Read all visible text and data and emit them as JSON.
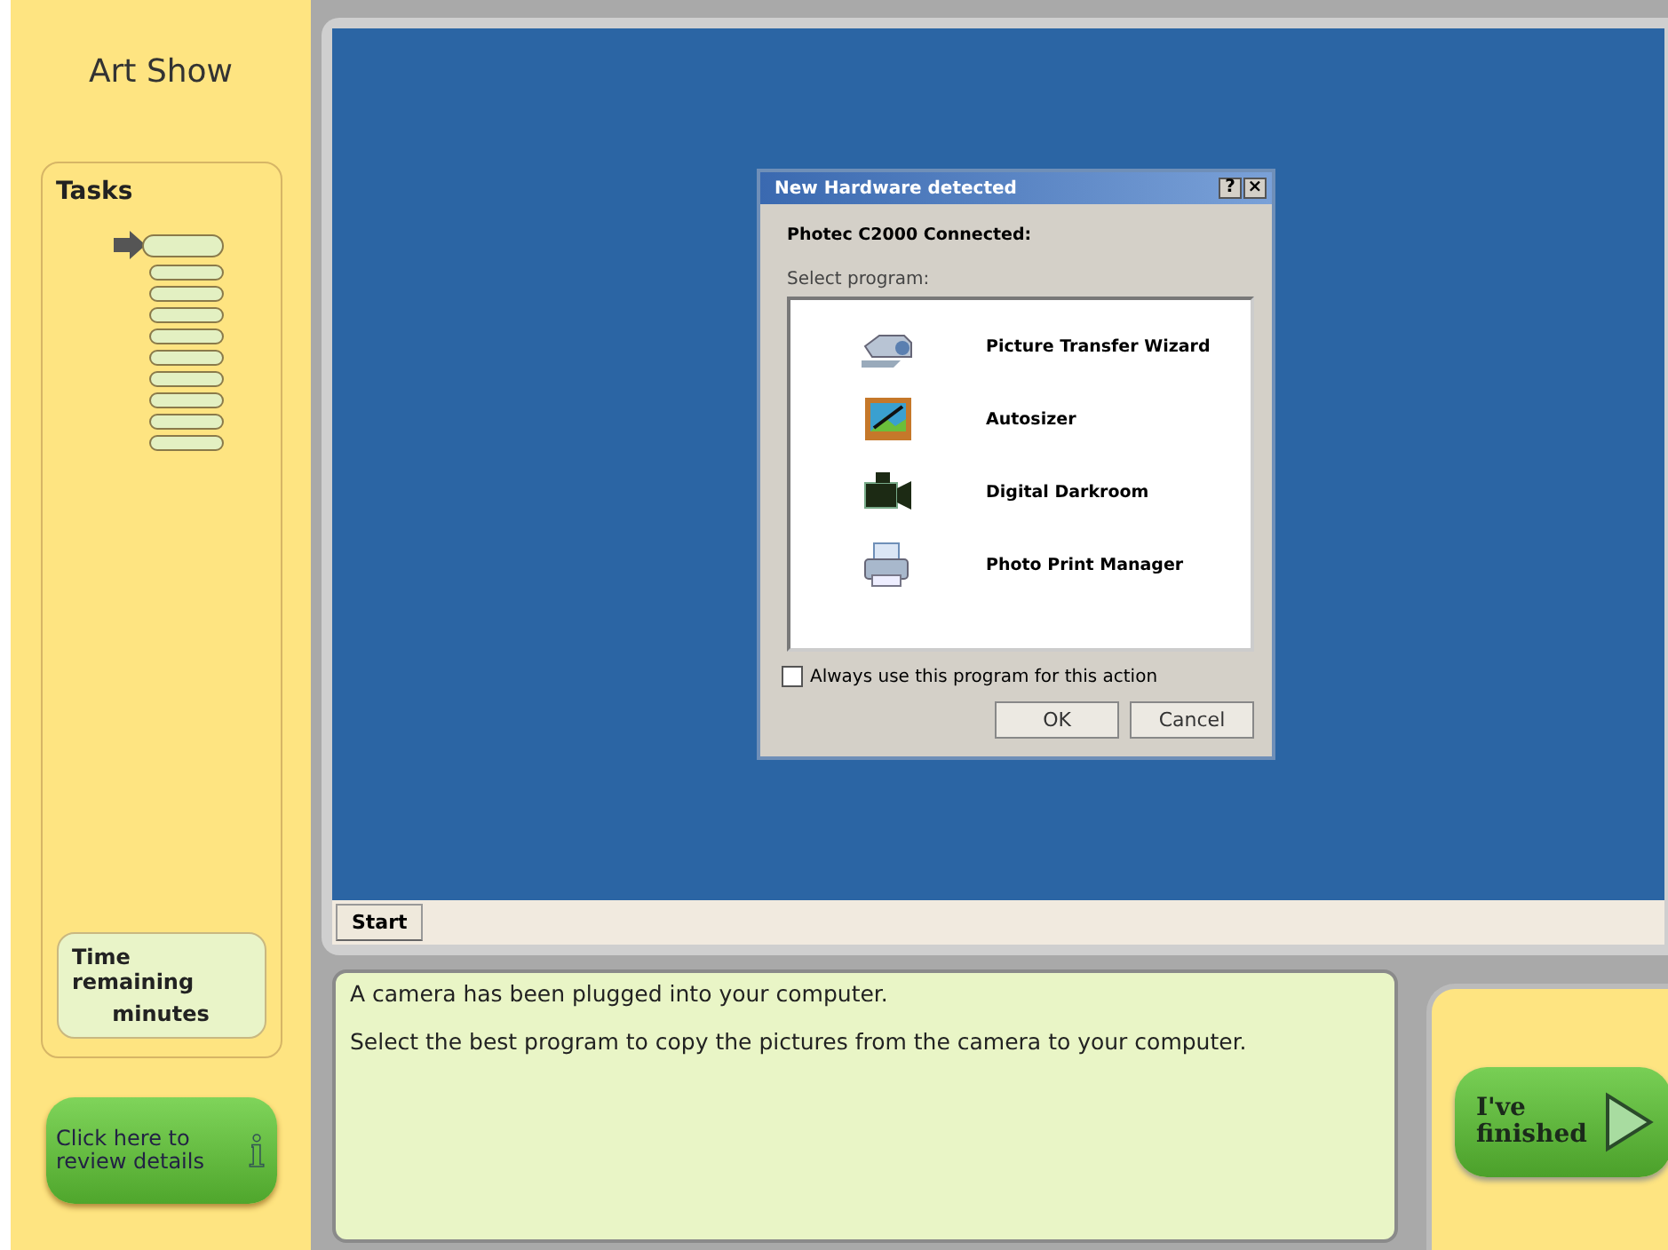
{
  "app_title": "Art Show",
  "tasks": {
    "label": "Tasks",
    "items": [
      {
        "current": true
      },
      {
        "current": false
      },
      {
        "current": false
      },
      {
        "current": false
      },
      {
        "current": false
      },
      {
        "current": false
      },
      {
        "current": false
      },
      {
        "current": false
      },
      {
        "current": false
      },
      {
        "current": false
      }
    ]
  },
  "timer": {
    "label": "Time remaining",
    "unit": "minutes"
  },
  "review_button": "Click here to review details",
  "dialog": {
    "title": "New Hardware detected",
    "help": "?",
    "close": "×",
    "heading": "Photec C2000 Connected:",
    "list_label": "Select program:",
    "programs": [
      {
        "kind": "scanner",
        "name": "Picture Transfer Wizard"
      },
      {
        "kind": "resize",
        "name": "Autosizer"
      },
      {
        "kind": "camcorder",
        "name": "Digital Darkroom"
      },
      {
        "kind": "printer",
        "name": "Photo Print Manager"
      }
    ],
    "always": {
      "label": "Always use this program for this action",
      "checked": false
    },
    "buttons": [
      "OK",
      "Cancel"
    ]
  },
  "taskbar": {
    "start": "Start"
  },
  "instructions": [
    "A camera has been plugged into your computer.",
    "Select the best program to copy the pictures from the camera to your computer."
  ],
  "finish_button": "I've finished"
}
